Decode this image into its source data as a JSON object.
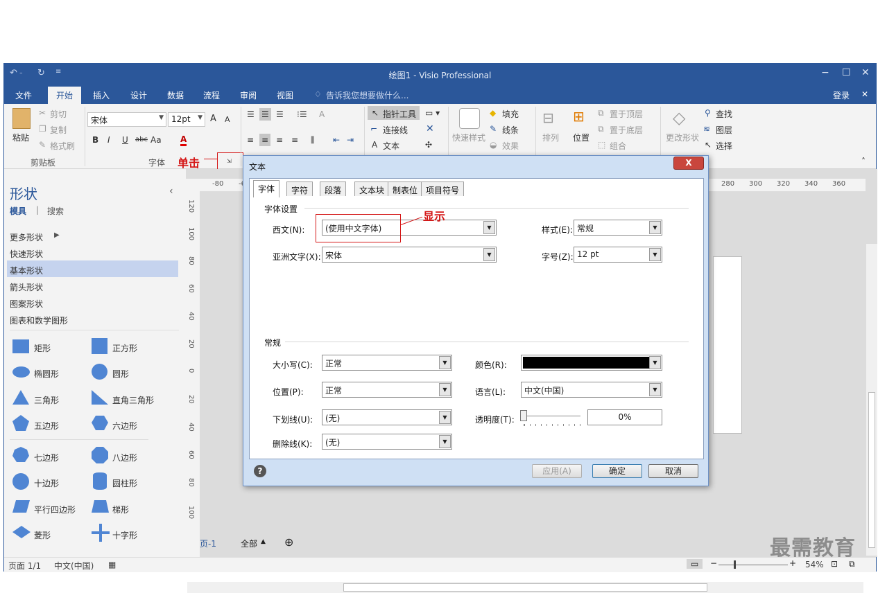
{
  "window": {
    "title": "绘图1 - Visio Professional",
    "minimize": "−",
    "maximize": "☐",
    "close": "✕"
  },
  "quick_access": {
    "undo": "↶",
    "sep": "-",
    "redo": "↻",
    "more": "≡"
  },
  "menu_tabs": [
    "文件",
    "开始",
    "插入",
    "设计",
    "数据",
    "流程",
    "审阅",
    "视图"
  ],
  "tell_me": "告诉我您想要做什么...",
  "login": "登录",
  "ribbon": {
    "clipboard": {
      "paste": "粘贴",
      "cut": "剪切",
      "copy": "复制",
      "format_painter": "格式刷",
      "label": "剪贴板"
    },
    "font": {
      "name": "宋体",
      "size": "12pt",
      "bold": "B",
      "italic": "I",
      "underline": "U",
      "strike": "abc",
      "case": "Aa",
      "color": "A",
      "label": "字体",
      "grow": "A",
      "shrink": "A"
    },
    "tools": {
      "pointer": "指针工具",
      "connector": "连接线",
      "text": "文本"
    },
    "shape_styles": {
      "quick_styles": "快速样式",
      "fill": "填充",
      "line": "线条",
      "effects": "效果"
    },
    "arrange": {
      "arrange": "排列",
      "position": "位置",
      "bring_front": "置于顶层",
      "send_back": "置于底层",
      "group": "组合"
    },
    "editing": {
      "change_shape": "更改形状",
      "find": "查找",
      "layers": "图层",
      "select": "选择"
    }
  },
  "annotations": {
    "click": "单击",
    "show": "显示"
  },
  "shapes_pane": {
    "title": "形状",
    "tabs": [
      "模具",
      "搜索"
    ],
    "nav": [
      "更多形状",
      "快速形状",
      "基本形状",
      "箭头形状",
      "图案形状",
      "图表和数学图形"
    ],
    "selected_nav": "基本形状",
    "items": [
      "矩形",
      "正方形",
      "椭圆形",
      "圆形",
      "三角形",
      "直角三角形",
      "五边形",
      "六边形",
      "七边形",
      "八边形",
      "十边形",
      "圆柱形",
      "平行四边形",
      "梯形",
      "菱形",
      "十字形"
    ]
  },
  "ruler": {
    "top": [
      "-80",
      "-60",
      "280",
      "300",
      "320",
      "340",
      "360"
    ],
    "left": [
      "120",
      "100",
      "80",
      "60",
      "40",
      "20",
      "0",
      "20",
      "40",
      "60",
      "80",
      "100"
    ]
  },
  "page_tabs": {
    "page": "页-1",
    "all": "全部"
  },
  "dialog": {
    "title": "文本",
    "tabs": [
      "字体",
      "字符",
      "段落",
      "文本块",
      "制表位",
      "项目符号"
    ],
    "font_settings": "字体设置",
    "latin_label": "西文(N):",
    "latin_value": "(使用中文字体)",
    "asian_label": "亚洲文字(X):",
    "asian_value": "宋体",
    "style_label": "样式(E):",
    "style_value": "常规",
    "size_label": "字号(Z):",
    "size_value": "12 pt",
    "general": "常规",
    "case_label": "大小写(C):",
    "case_value": "正常",
    "position_label": "位置(P):",
    "position_value": "正常",
    "underline_label": "下划线(U):",
    "underline_value": "(无)",
    "strike_label": "删除线(K):",
    "strike_value": "(无)",
    "color_label": "颜色(R):",
    "color_value": "#000000",
    "lang_label": "语言(L):",
    "lang_value": "中文(中国)",
    "transparency_label": "透明度(T):",
    "transparency_value": "0%",
    "apply": "应用(A)",
    "ok": "确定",
    "cancel": "取消",
    "close": "X"
  },
  "status": {
    "page": "页面 1/1",
    "lang": "中文(中国)",
    "zoom": "54%"
  },
  "watermark": "最需教育",
  "colors": {
    "accent": "#2b579a",
    "annotation": "#d41616"
  }
}
